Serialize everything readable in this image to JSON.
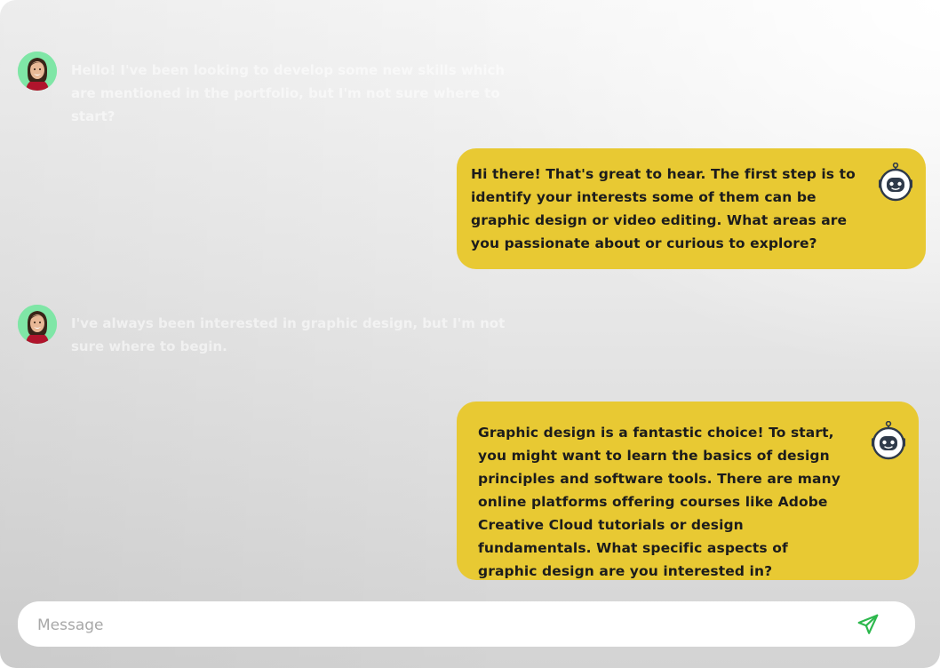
{
  "messages": [
    {
      "role": "user",
      "avatar": "woman-avatar",
      "text": "Hello! I've been looking to develop some new skills which are mentioned in the portfolio, but I'm not sure where to start?"
    },
    {
      "role": "bot",
      "avatar": "robot-icon",
      "text": "Hi there! That's great to hear. The first step is to identify your interests some of them can be graphic design or video editing. What areas are you passionate about or curious to explore?"
    },
    {
      "role": "user",
      "avatar": "woman-avatar",
      "text": "I've always been interested in graphic design, but I'm not sure where to begin."
    },
    {
      "role": "bot",
      "avatar": "robot-icon",
      "text": "Graphic design is a fantastic choice! To start, you might want to learn the basics of design principles and software tools. There are many online platforms offering courses like Adobe Creative Cloud tutorials or design fundamentals. What specific aspects of graphic design are you interested in?"
    }
  ],
  "composer": {
    "placeholder": "Message",
    "send_icon": "send-icon"
  },
  "colors": {
    "bot_bubble": "#e8c933",
    "avatar_bg": "#7fe6a6",
    "send_icon": "#2db84d"
  }
}
